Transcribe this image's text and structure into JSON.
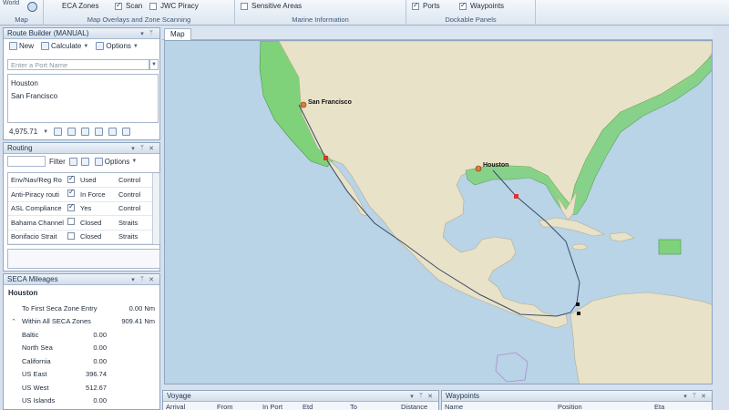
{
  "ribbon": {
    "world_label": "World",
    "groups": [
      {
        "label": "Map"
      },
      {
        "label": "Map Overlays and Zone Scanning"
      },
      {
        "label": "Marine Information"
      },
      {
        "label": "Dockable Panels"
      }
    ],
    "eca_zones": "ECA Zones",
    "scan": "Scan",
    "jwc_piracy": "JWC Piracy",
    "sensitive_areas": "Sensitive Areas",
    "ports": "Ports",
    "waypoints": "Waypoints"
  },
  "route_builder": {
    "title": "Route Builder (MANUAL)",
    "new_label": "New",
    "calculate_label": "Calculate",
    "options_label": "Options",
    "port_placeholder": "Enter a Port Name",
    "ports": [
      "Houston",
      "San Francisco"
    ],
    "distance": "4,975.71"
  },
  "routing": {
    "title": "Routing",
    "filter_label": "Filter",
    "options_label": "Options",
    "rows": [
      {
        "name": "Env/Nav/Reg Ro",
        "checked": true,
        "status": "Used",
        "type": "Control"
      },
      {
        "name": "Anti-Piracy routi",
        "checked": true,
        "status": "In Force",
        "type": "Control"
      },
      {
        "name": "ASL Compliance",
        "checked": true,
        "status": "Yes",
        "type": "Control"
      },
      {
        "name": "Bahama Channel",
        "checked": false,
        "status": "Closed",
        "type": "Straits"
      },
      {
        "name": "Bonifacio Strait",
        "checked": false,
        "status": "Closed",
        "type": "Straits"
      }
    ]
  },
  "seca": {
    "title": "SECA Mileages",
    "port": "Houston",
    "first_entry_label": "To First Seca Zone Entry",
    "first_entry_value": "0.00 Nm",
    "within_label": "Within All SECA Zones",
    "within_value": "909.41 Nm",
    "zones": [
      {
        "name": "Baltic",
        "value": "0.00"
      },
      {
        "name": "North Sea",
        "value": "0.00"
      },
      {
        "name": "California",
        "value": "0.00"
      },
      {
        "name": "US East",
        "value": "396.74"
      },
      {
        "name": "US West",
        "value": "512.67"
      },
      {
        "name": "US Islands",
        "value": "0.00"
      }
    ]
  },
  "map": {
    "tab_label": "Map",
    "san_francisco_label": "San Francisco",
    "houston_label": "Houston"
  },
  "voyage": {
    "title": "Voyage",
    "columns": [
      "Arrival",
      "From",
      "In Port",
      "Etd",
      "To",
      "Distance"
    ]
  },
  "waypoints_panel": {
    "title": "Waypoints",
    "columns": [
      "Name",
      "Position",
      "Eta"
    ]
  },
  "colors": {
    "sea": "#b9d3e7",
    "land": "#e8e2c8",
    "eca_zone": "#7fd27a",
    "route": "#3a4a66",
    "waypoint_marker": "#e0322d"
  }
}
